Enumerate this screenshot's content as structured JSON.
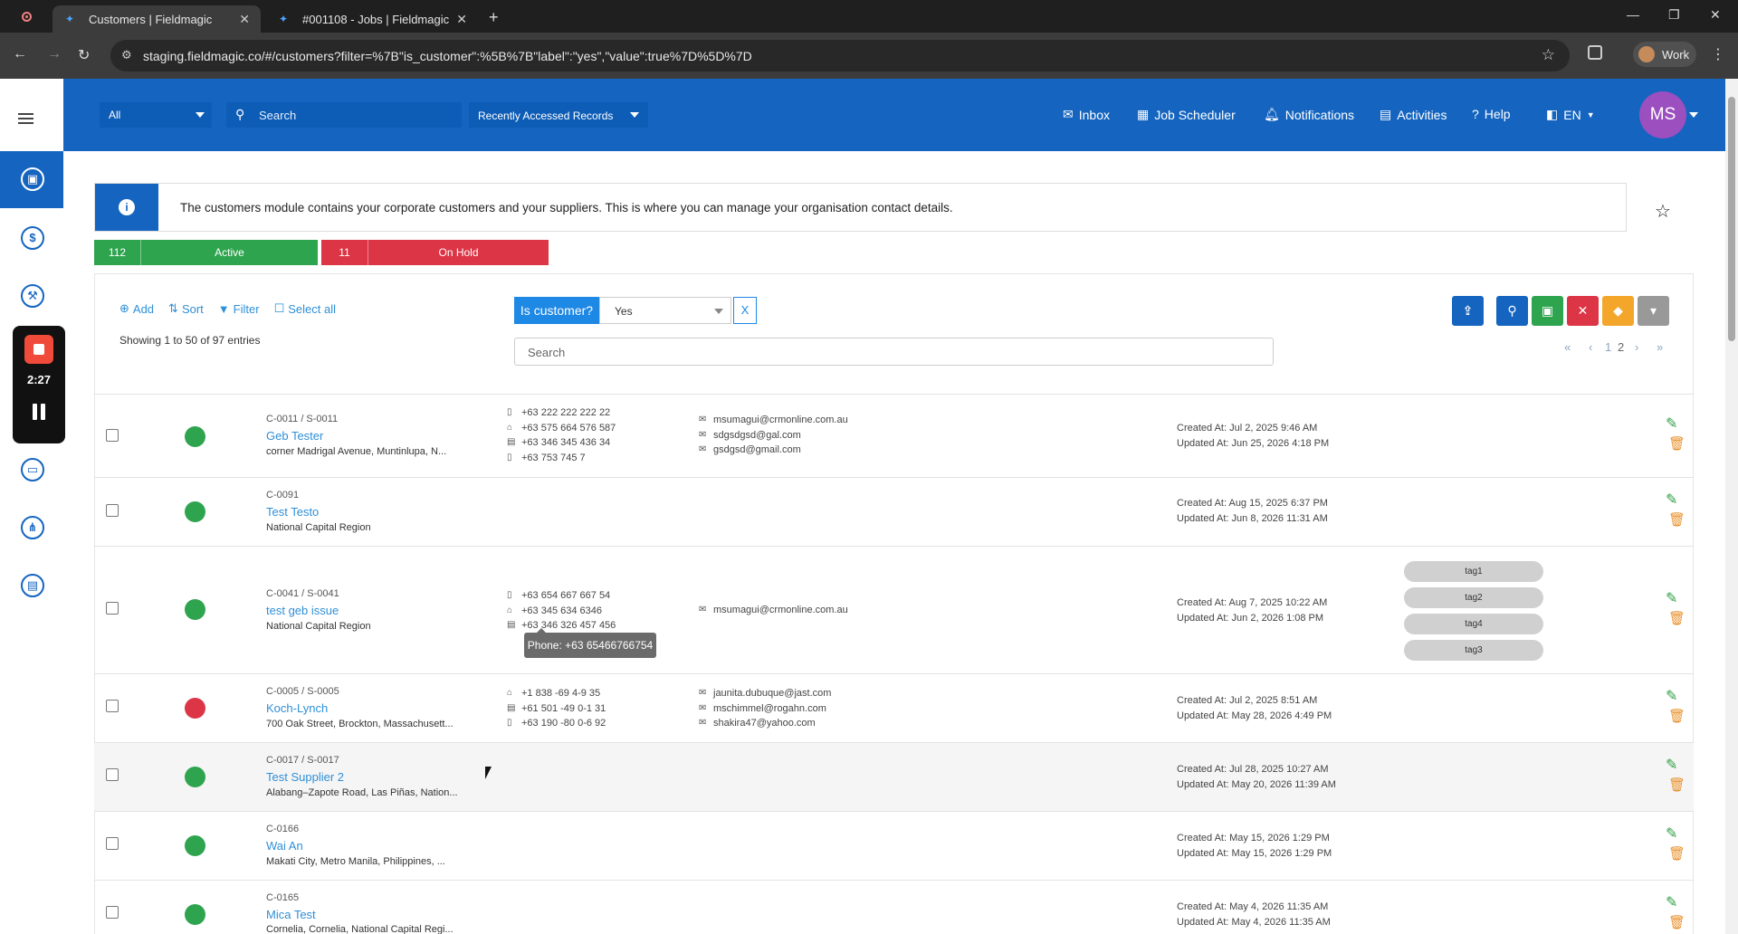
{
  "browser": {
    "tabs": [
      {
        "title": "Customers | Fieldmagic",
        "active": true
      },
      {
        "title": "#001108 - Jobs | Fieldmagic",
        "active": false
      }
    ],
    "url": "staging.fieldmagic.co/#/customers?filter=%7B\"is_customer\":%5B%7B\"label\":\"yes\",\"value\":true%7D%5D%7D",
    "profile": "Work"
  },
  "header": {
    "module_select": "All",
    "search_placeholder": "Search",
    "recent_label": "Recently Accessed Records",
    "nav": {
      "inbox": "Inbox",
      "job_scheduler": "Job Scheduler",
      "notifications": "Notifications",
      "activities": "Activities",
      "help": "Help",
      "language": "EN"
    },
    "avatar": "MS"
  },
  "recorder": {
    "time": "2:27"
  },
  "info": {
    "text": "The customers module contains your corporate customers and your suppliers. This is where you can manage your organisation contact details."
  },
  "stats": {
    "active": {
      "count": "112",
      "label": "Active",
      "color": "#2fa44f"
    },
    "on_hold": {
      "count": "11",
      "label": "On Hold",
      "color": "#dc3545"
    }
  },
  "toolbar": {
    "add": "Add",
    "sort": "Sort",
    "filter": "Filter",
    "select_all": "Select all"
  },
  "showing": "Showing 1 to 50 of 97 entries",
  "filter": {
    "label": "Is customer?",
    "value": "Yes",
    "clear": "X"
  },
  "list_search_placeholder": "Search",
  "pagination": {
    "page1": "1",
    "page2": "2"
  },
  "tooltip": "Phone: +63 65466766754",
  "rows": [
    {
      "code": "C-0011 / S-0011",
      "name": "Geb Tester",
      "address": "corner Madrigal Avenue, Muntinlupa, N...",
      "status": "active",
      "phones": [
        "+63 222 222 222 22",
        "+63 575 664 576 587",
        "+63 346 345 436 34",
        "+63 753 745 7"
      ],
      "emails": [
        "msumagui@crmonline.com.au",
        "sdgsdgsd@gal.com",
        "gsdgsd@gmail.com"
      ],
      "created": "Created At: Jul 2, 2025 9:46 AM",
      "updated": "Updated At: Jun 25, 2026 4:18 PM",
      "tags": []
    },
    {
      "code": "C-0091",
      "name": "Test Testo",
      "address": "National Capital Region",
      "status": "active",
      "phones": [],
      "emails": [],
      "created": "Created At: Aug 15, 2025 6:37 PM",
      "updated": "Updated At: Jun 8, 2026 11:31 AM",
      "tags": []
    },
    {
      "code": "C-0041 / S-0041",
      "name": "test geb issue",
      "address": "National Capital Region",
      "status": "active",
      "phones": [
        "+63 654 667 667 54",
        "+63 345 634 6346",
        "+63 346 326 457 456"
      ],
      "emails": [
        "msumagui@crmonline.com.au"
      ],
      "created": "Created At: Aug 7, 2025 10:22 AM",
      "updated": "Updated At: Jun 2, 2026 1:08 PM",
      "tags": [
        "tag1",
        "tag2",
        "tag4",
        "tag3"
      ]
    },
    {
      "code": "C-0005 / S-0005",
      "name": "Koch-Lynch",
      "address": "700 Oak Street, Brockton, Massachusett...",
      "status": "on_hold",
      "phones": [
        "+1 838 -69 4-9 35",
        "+61 501 -49 0-1 31",
        "+63 190 -80 0-6 92"
      ],
      "emails": [
        "jaunita.dubuque@jast.com",
        "mschimmel@rogahn.com",
        "shakira47@yahoo.com"
      ],
      "created": "Created At: Jul 2, 2025 8:51 AM",
      "updated": "Updated At: May 28, 2026 4:49 PM",
      "tags": []
    },
    {
      "code": "C-0017 / S-0017",
      "name": "Test Supplier 2",
      "address": "Alabang–Zapote Road, Las Piñas, Nation...",
      "status": "active",
      "phones": [],
      "emails": [],
      "created": "Created At: Jul 28, 2025 10:27 AM",
      "updated": "Updated At: May 20, 2026 11:39 AM",
      "tags": []
    },
    {
      "code": "C-0166",
      "name": "Wai An",
      "address": "Makati City, Metro Manila, Philippines, ...",
      "status": "active",
      "phones": [],
      "emails": [],
      "created": "Created At: May 15, 2026 1:29 PM",
      "updated": "Updated At: May 15, 2026 1:29 PM",
      "tags": []
    },
    {
      "code": "C-0165",
      "name": "Mica Test",
      "address": "Cornelia, Cornelia, National Capital Regi...",
      "status": "active",
      "phones": [],
      "emails": [],
      "created": "Created At: May 4, 2026 11:35 AM",
      "updated": "Updated At: May 4, 2026 11:35 AM",
      "tags": []
    }
  ],
  "colors": {
    "primary": "#1565c0",
    "link": "#2f8fd8",
    "active": "#2fa44f",
    "on_hold": "#dc3545"
  }
}
